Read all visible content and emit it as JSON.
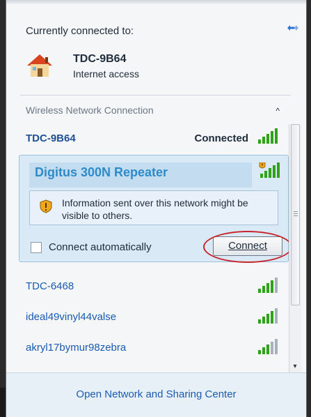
{
  "popup": {
    "header": "Currently connected to:",
    "connected_network": {
      "name": "TDC-9B64",
      "status": "Internet access"
    },
    "section_title": "Wireless Network Connection",
    "section_toggle": "^",
    "networks": [
      {
        "name": "TDC-9B64",
        "status": "Connected"
      },
      {
        "name": "Digitus 300N Repeater"
      },
      {
        "name": "TDC-6468"
      },
      {
        "name": "ideal49vinyl44valse"
      },
      {
        "name": "akryl17bymur98zebra"
      }
    ],
    "expanded": {
      "warning_text": "Information sent over this network might be visible to others.",
      "auto_label": "Connect automatically",
      "auto_checked": false,
      "connect_button": "Connect"
    },
    "footer_link": "Open Network and Sharing Center"
  },
  "colors": {
    "accent_blue": "#1a5ab0",
    "highlight_title": "#2d8bc9",
    "annotation_red": "#c8242b",
    "signal_green": "#2fa21a"
  },
  "icons": {
    "top_right": "network-refresh-icon",
    "house": "home-network-icon",
    "signal": "wifi-signal-icon",
    "secured_signal": "unsecured-wifi-signal-icon",
    "warning": "shield-warning-icon"
  }
}
